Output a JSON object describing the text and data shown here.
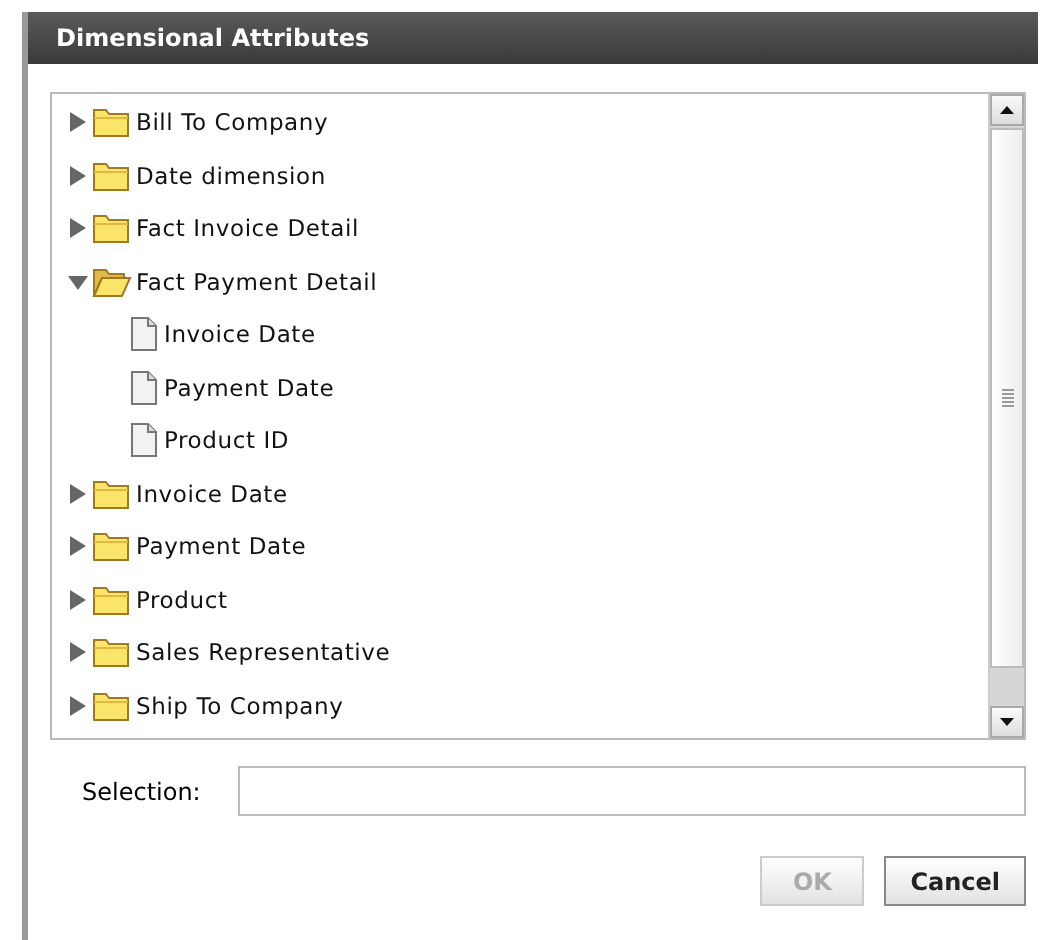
{
  "window": {
    "title": "Dimensional Attributes"
  },
  "tree": [
    {
      "kind": "folder",
      "label": "Bill To Company",
      "expanded": false
    },
    {
      "kind": "folder",
      "label": "Date dimension",
      "expanded": false
    },
    {
      "kind": "folder",
      "label": "Fact Invoice Detail",
      "expanded": false
    },
    {
      "kind": "folder",
      "label": "Fact Payment Detail",
      "expanded": true,
      "children": [
        {
          "kind": "file",
          "label": "Invoice Date"
        },
        {
          "kind": "file",
          "label": "Payment Date"
        },
        {
          "kind": "file",
          "label": "Product ID"
        }
      ]
    },
    {
      "kind": "folder",
      "label": "Invoice Date",
      "expanded": false
    },
    {
      "kind": "folder",
      "label": "Payment Date",
      "expanded": false
    },
    {
      "kind": "folder",
      "label": "Product",
      "expanded": false
    },
    {
      "kind": "folder",
      "label": "Sales Representative",
      "expanded": false
    },
    {
      "kind": "folder",
      "label": "Ship To Company",
      "expanded": false
    }
  ],
  "selection": {
    "label": "Selection:"
  },
  "buttons": [
    {
      "label": "OK",
      "disabled": true
    },
    {
      "label": "Cancel",
      "disabled": false
    }
  ]
}
